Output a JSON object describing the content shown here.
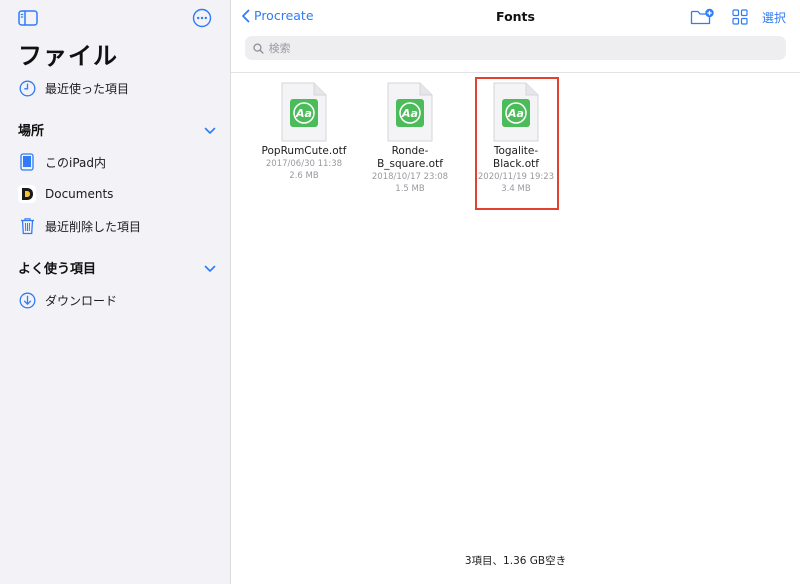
{
  "sidebar": {
    "title": "ファイル",
    "recents_label": "最近使った項目",
    "locations": {
      "header": "場所",
      "items": [
        {
          "label": "このiPad内"
        },
        {
          "label": "Documents"
        },
        {
          "label": "最近削除した項目"
        }
      ]
    },
    "favorites": {
      "header": "よく使う項目",
      "items": [
        {
          "label": "ダウンロード"
        }
      ]
    }
  },
  "nav": {
    "back_label": "Procreate",
    "title": "Fonts",
    "select_label": "選択"
  },
  "search": {
    "placeholder": "検索"
  },
  "files": [
    {
      "name_line1": "PopRumCute.otf",
      "name_line2": "",
      "date": "2017/06/30 11:38",
      "size": "2.6 MB",
      "icon_text": "Aa"
    },
    {
      "name_line1": "Ronde-",
      "name_line2": "B_square.otf",
      "date": "2018/10/17 23:08",
      "size": "1.5 MB",
      "icon_text": "Aa"
    },
    {
      "name_line1": "Togalite-",
      "name_line2": "Black.otf",
      "date": "2020/11/19 19:23",
      "size": "3.4 MB",
      "icon_text": "Aa",
      "highlighted": true
    }
  ],
  "footer": {
    "status": "3項目、1.36 GB空き"
  },
  "colors": {
    "accent": "#2f7cf6",
    "sidebar_bg": "#f2f2f7",
    "font_icon_green": "#4cbb5a",
    "highlight_red": "#e5402f"
  }
}
